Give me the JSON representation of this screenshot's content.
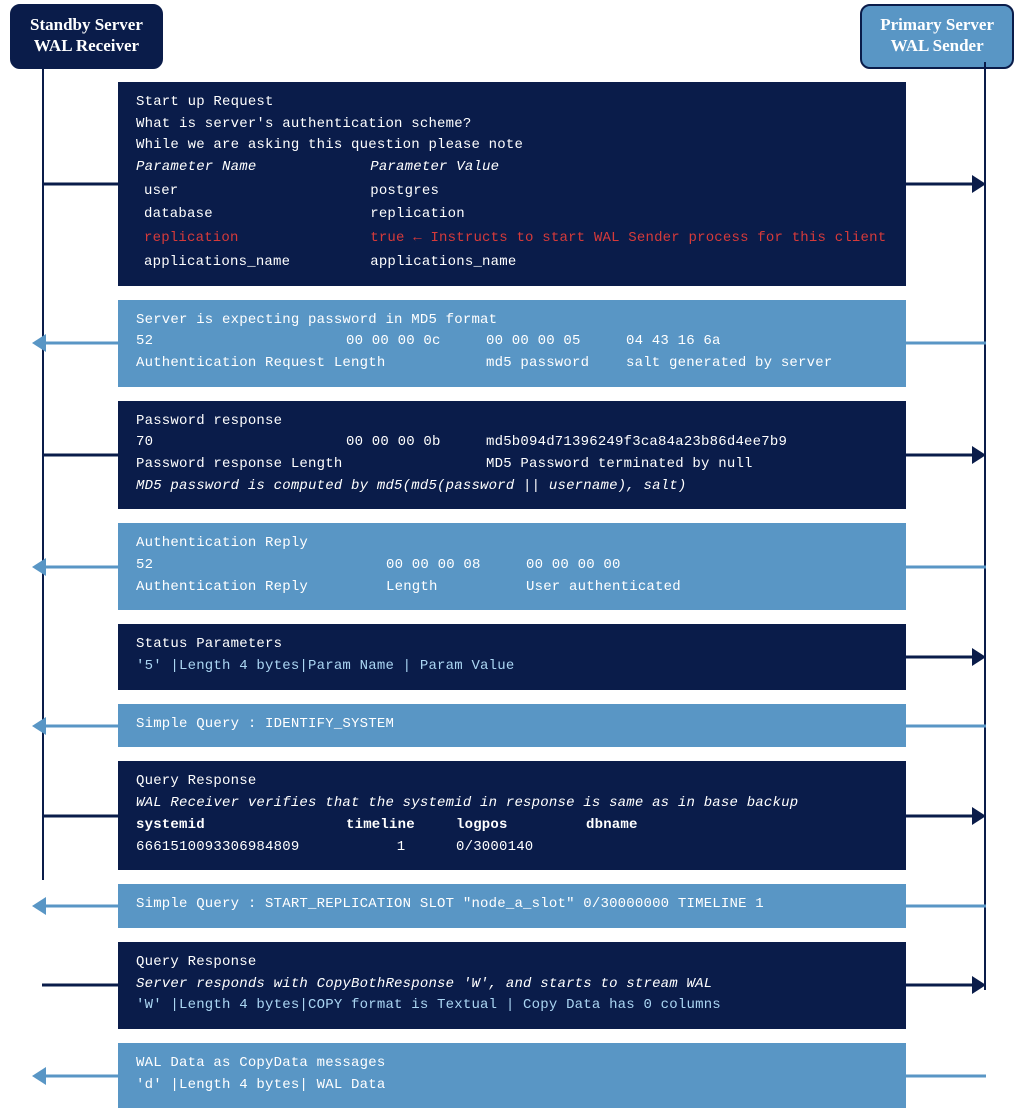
{
  "headers": {
    "standby_l1": "Standby Server",
    "standby_l2": "WAL Receiver",
    "primary_l1": "Primary Server",
    "primary_l2": "WAL Sender"
  },
  "m1": {
    "l1": "Start up Request",
    "l2": "What is server's authentication scheme?",
    "l3": "While we are asking this question please note",
    "param_name_hdr": "Parameter Name",
    "param_value_hdr": "Parameter Value",
    "rows": {
      "user_k": "user",
      "user_v": "postgres",
      "database_k": "database",
      "database_v": "replication",
      "replication_k": "replication",
      "replication_v": "true ← Instructs to start WAL Sender process for this client",
      "appname_k": "applications_name",
      "appname_v": "applications_name"
    }
  },
  "m2": {
    "l1": "Server is expecting password in MD5 format",
    "c1": "52",
    "c2": "00 00 00 0c",
    "c3": "00 00 00 05",
    "c4": "04 43 16 6a",
    "d1": "Authentication Request Length",
    "d2": "md5 password",
    "d3": "salt generated by server"
  },
  "m3": {
    "l1": "Password response",
    "c1": "70",
    "c2": "00 00 00 0b",
    "c3": "md5b094d71396249f3ca84a23b86d4ee7b9",
    "d1": "Password response Length",
    "d2": "MD5 Password terminated by null",
    "note": "MD5 password is computed by md5(md5(password || username), salt)"
  },
  "m4": {
    "l1": "Authentication Reply",
    "c1": "52",
    "c2": "00 00 00 08",
    "c3": "00 00 00 00",
    "d1": "Authentication Reply",
    "d2": "Length",
    "d3": "User authenticated"
  },
  "m5": {
    "l1": "Status Parameters",
    "l2": "'5'  |Length 4 bytes|Param Name | Param Value"
  },
  "m6": {
    "l1": "Simple Query : IDENTIFY_SYSTEM"
  },
  "m7": {
    "l1": "Query Response",
    "note": "WAL Receiver verifies that the systemid in response is same as in base backup",
    "h1": "systemid",
    "h2": "timeline",
    "h3": "logpos",
    "h4": "dbname",
    "v1": "6661510093306984809",
    "v2": "1",
    "v3": "0/3000140",
    "v4": ""
  },
  "m8": {
    "l1": "Simple Query : START_REPLICATION SLOT \"node_a_slot\" 0/30000000 TIMELINE 1"
  },
  "m9": {
    "l1": "Query Response",
    "note": "Server responds with CopyBothResponse 'W', and starts to stream WAL",
    "l3": "'W'  |Length 4 bytes|COPY format is Textual | Copy Data has 0 columns"
  },
  "m10": {
    "l1": "WAL Data as CopyData messages",
    "l2": "'d'  |Length 4 bytes| WAL Data"
  }
}
